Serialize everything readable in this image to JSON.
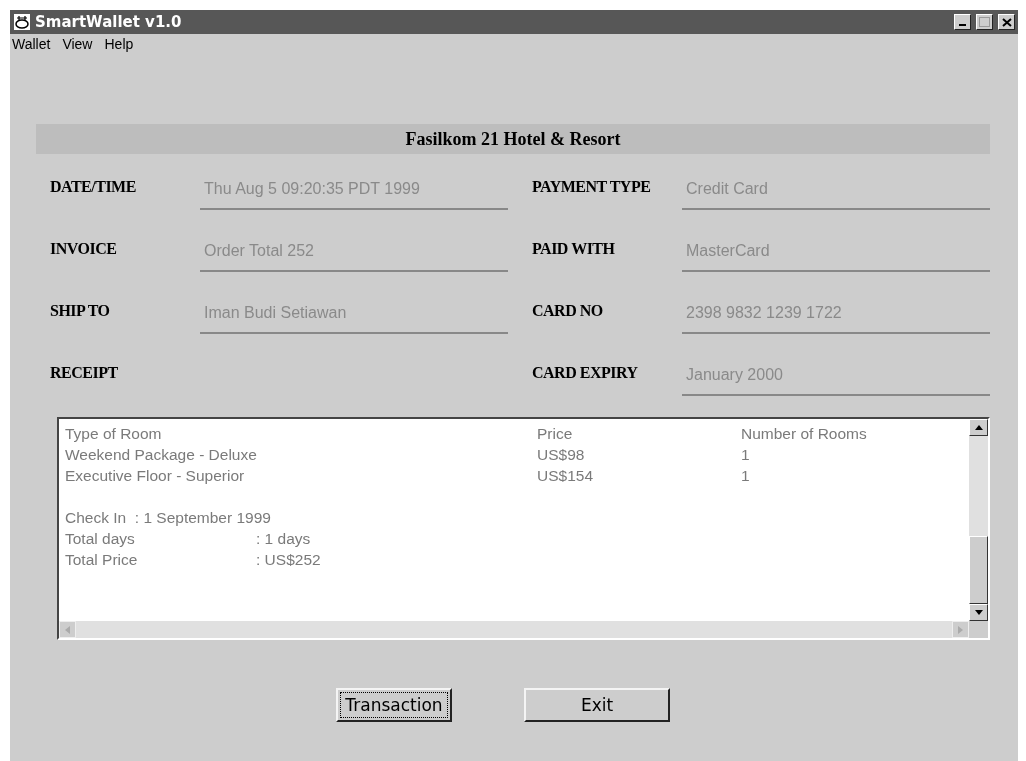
{
  "window": {
    "title": "SmartWallet v1.0"
  },
  "menu": [
    "Wallet",
    "View",
    "Help"
  ],
  "header": "Fasilkom 21 Hotel & Resort",
  "fields_left": [
    {
      "label": "DATE/TIME",
      "value": "Thu Aug 5 09:20:35 PDT 1999"
    },
    {
      "label": "INVOICE",
      "value": "Order Total 252"
    },
    {
      "label": "SHIP TO",
      "value": "Iman Budi Setiawan"
    },
    {
      "label": "RECEIPT"
    }
  ],
  "fields_right": [
    {
      "label": "PAYMENT TYPE",
      "value": "Credit Card"
    },
    {
      "label": "PAID WITH",
      "value": "MasterCard"
    },
    {
      "label": "CARD NO",
      "value": "2398 9832 1239 1722"
    },
    {
      "label": "CARD EXPIRY",
      "value": "January 2000"
    }
  ],
  "receipt": {
    "columns": [
      "Type of Room",
      "Price",
      "Number of Rooms"
    ],
    "rows": [
      [
        "Weekend Package - Deluxe",
        "US$98",
        "1"
      ],
      [
        "Executive Floor - Superior",
        "US$154",
        "1"
      ]
    ],
    "summary": [
      {
        "kind": "inline",
        "text": "Check In  : 1 September 1999"
      },
      {
        "kind": "tabbed",
        "label": "Total days",
        "value": ": 1 days"
      },
      {
        "kind": "tabbed",
        "label": "Total Price",
        "value": ": US$252"
      }
    ]
  },
  "buttons": [
    {
      "label": "Transaction",
      "focused": true
    },
    {
      "label": "Exit",
      "focused": false
    }
  ]
}
